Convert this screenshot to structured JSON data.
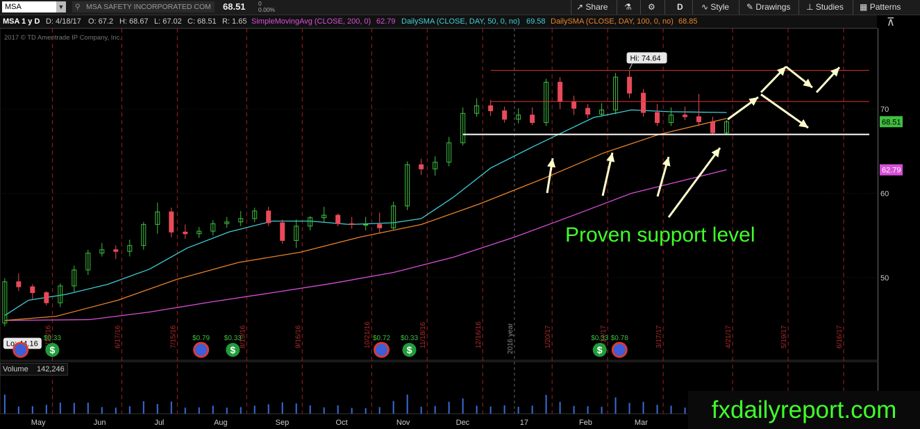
{
  "toolbar": {
    "symbol": "MSA",
    "company": "MSA SAFETY INCORPORATED COM",
    "last_price": "68.51",
    "change_top": "0",
    "change_pct": "0.00%",
    "share_label": "Share",
    "timeframe": "D",
    "style_label": "Style",
    "drawings_label": "Drawings",
    "studies_label": "Studies",
    "patterns_label": "Patterns"
  },
  "header": {
    "title": "MSA 1 y D",
    "date": "D: 4/18/17",
    "open": "O: 67.2",
    "high": "H: 68.67",
    "low": "L: 67.02",
    "close": "C: 68.51",
    "range": "R: 1.65",
    "sma200_label": "SimpleMovingAvg (CLOSE, 200, 0)",
    "sma200_value": "62.79",
    "sma50_label": "DailySMA (CLOSE, DAY, 50, 0, no)",
    "sma50_value": "69.58",
    "sma100_label": "DailySMA (CLOSE, DAY, 100, 0, no)",
    "sma100_value": "68.85"
  },
  "copyright": "2017 © TD Ameritrade IP Company, Inc.",
  "colors": {
    "sma50": "#3fd0d8",
    "sma100": "#e8832a",
    "sma200": "#d84fd8",
    "up": "#3fbf3f",
    "down": "#e84a5a",
    "annotation": "#40ff2a",
    "resistance": "#e03030",
    "support": "#ffffff"
  },
  "annotation": "Proven support level",
  "brand": "fxdailyreport.com",
  "volume": {
    "label": "Volume",
    "value": "142,246"
  },
  "chart_data": {
    "type": "candlestick",
    "title": "MSA 1 y D",
    "ylim": [
      40.5,
      79.5
    ],
    "y_ticks": [
      50,
      60,
      70
    ],
    "price_labels": {
      "last": "68.51",
      "sma200": "62.79"
    },
    "hi_label": "Hi: 74.64",
    "lo_label": "Lo: 44.16",
    "x_range": [
      "2016-04-18",
      "2017-06-30"
    ],
    "month_labels": [
      {
        "label": "May",
        "date": "2016-05-01"
      },
      {
        "label": "Jun",
        "date": "2016-06-01"
      },
      {
        "label": "Jul",
        "date": "2016-07-01"
      },
      {
        "label": "Aug",
        "date": "2016-08-01"
      },
      {
        "label": "Sep",
        "date": "2016-09-01"
      },
      {
        "label": "Oct",
        "date": "2016-10-01"
      },
      {
        "label": "Nov",
        "date": "2016-11-01"
      },
      {
        "label": "Dec",
        "date": "2016-12-01"
      },
      {
        "label": "17",
        "date": "2017-01-01"
      },
      {
        "label": "Feb",
        "date": "2017-02-01"
      },
      {
        "label": "Mar",
        "date": "2017-03-01"
      }
    ],
    "event_dates": [
      {
        "label": "5/13/16",
        "date": "2016-05-13"
      },
      {
        "label": "6/17/16",
        "date": "2016-06-17"
      },
      {
        "label": "7/15/16",
        "date": "2016-07-15"
      },
      {
        "label": "8/19/16",
        "date": "2016-08-19"
      },
      {
        "label": "9/16/16",
        "date": "2016-09-16"
      },
      {
        "label": "10/21/16",
        "date": "2016-10-21"
      },
      {
        "label": "11/18/16",
        "date": "2016-11-18"
      },
      {
        "label": "12/16/16",
        "date": "2016-12-16"
      },
      {
        "label": "1/20/17",
        "date": "2017-01-20"
      },
      {
        "label": "2/17/17",
        "date": "2017-02-17"
      },
      {
        "label": "3/17/17",
        "date": "2017-03-17"
      },
      {
        "label": "4/21/17",
        "date": "2017-04-21"
      },
      {
        "label": "5/19/17",
        "date": "2017-05-19"
      },
      {
        "label": "6/16/17",
        "date": "2017-06-16"
      }
    ],
    "year_marker": {
      "label": "2016 year",
      "date": "2017-01-01"
    },
    "events": [
      {
        "type": "earnings",
        "date": "2016-04-27"
      },
      {
        "type": "dividend",
        "label": "$0.33",
        "date": "2016-05-13"
      },
      {
        "type": "earnings",
        "label": "$0.79",
        "date": "2016-07-27"
      },
      {
        "type": "dividend",
        "label": "$0.33",
        "date": "2016-08-12"
      },
      {
        "type": "earnings",
        "label": "$0.72",
        "date": "2016-10-26"
      },
      {
        "type": "dividend",
        "label": "$0.33",
        "date": "2016-11-09"
      },
      {
        "type": "dividend",
        "label": "$0.33",
        "date": "2017-02-13"
      },
      {
        "type": "earnings",
        "label": "$0.78",
        "date": "2017-02-23"
      }
    ],
    "sma50": {
      "dates": [
        "2016-04-19",
        "2016-05-01",
        "2016-05-20",
        "2016-06-10",
        "2016-07-01",
        "2016-07-20",
        "2016-08-10",
        "2016-09-01",
        "2016-09-20",
        "2016-10-10",
        "2016-11-01",
        "2016-11-15",
        "2016-12-01",
        "2016-12-20",
        "2017-01-10",
        "2017-01-25",
        "2017-02-10",
        "2017-03-01",
        "2017-03-20",
        "2017-04-18"
      ],
      "values": [
        45.5,
        47.3,
        48.0,
        49.2,
        51.0,
        53.5,
        55.4,
        56.7,
        56.7,
        56.3,
        56.5,
        57.0,
        59.5,
        63.0,
        65.5,
        67.2,
        69.0,
        69.9,
        69.7,
        69.6
      ]
    },
    "sma100": {
      "dates": [
        "2016-04-19",
        "2016-05-15",
        "2016-06-15",
        "2016-07-15",
        "2016-08-15",
        "2016-09-15",
        "2016-10-15",
        "2016-11-15",
        "2016-12-15",
        "2017-01-15",
        "2017-02-15",
        "2017-03-15",
        "2017-04-18"
      ],
      "values": [
        44.9,
        45.4,
        47.3,
        49.8,
        51.8,
        53.0,
        54.8,
        56.3,
        58.8,
        61.7,
        64.8,
        67.0,
        68.9
      ]
    },
    "sma200": {
      "dates": [
        "2016-04-19",
        "2016-06-01",
        "2016-07-01",
        "2016-08-01",
        "2016-09-01",
        "2016-10-01",
        "2016-11-01",
        "2016-12-01",
        "2017-01-01",
        "2017-02-01",
        "2017-03-01",
        "2017-04-18"
      ],
      "values": [
        44.9,
        45.0,
        45.9,
        47.1,
        48.2,
        49.3,
        50.6,
        52.4,
        54.8,
        57.5,
        60.0,
        62.8
      ]
    },
    "candles": {
      "dates": [
        "2016-04-19",
        "2016-04-26",
        "2016-05-03",
        "2016-05-10",
        "2016-05-17",
        "2016-05-24",
        "2016-05-31",
        "2016-06-07",
        "2016-06-14",
        "2016-06-21",
        "2016-06-28",
        "2016-07-05",
        "2016-07-12",
        "2016-07-19",
        "2016-07-26",
        "2016-08-02",
        "2016-08-09",
        "2016-08-16",
        "2016-08-23",
        "2016-08-30",
        "2016-09-06",
        "2016-09-13",
        "2016-09-20",
        "2016-09-27",
        "2016-10-04",
        "2016-10-11",
        "2016-10-18",
        "2016-10-25",
        "2016-11-01",
        "2016-11-08",
        "2016-11-15",
        "2016-11-22",
        "2016-11-29",
        "2016-12-06",
        "2016-12-13",
        "2016-12-20",
        "2016-12-27",
        "2017-01-03",
        "2017-01-10",
        "2017-01-17",
        "2017-01-24",
        "2017-01-31",
        "2017-02-07",
        "2017-02-14",
        "2017-02-21",
        "2017-02-28",
        "2017-03-07",
        "2017-03-14",
        "2017-03-21",
        "2017-03-28",
        "2017-04-04",
        "2017-04-11",
        "2017-04-18"
      ],
      "open": [
        44.6,
        49.5,
        48.9,
        48.2,
        47.0,
        49.0,
        50.9,
        52.9,
        53.3,
        53.1,
        53.8,
        56.3,
        57.8,
        55.4,
        55.2,
        55.5,
        56.4,
        56.6,
        57.0,
        57.9,
        56.5,
        54.4,
        56.1,
        57.1,
        57.4,
        56.4,
        56.3,
        56.3,
        55.9,
        58.5,
        63.4,
        62.9,
        63.7,
        66.0,
        69.5,
        70.4,
        69.8,
        68.8,
        69.3,
        68.4,
        73.2,
        70.9,
        70.1,
        69.4,
        69.9,
        73.8,
        71.9,
        69.6,
        68.4,
        69.3,
        69.1,
        68.5,
        67.2
      ],
      "high": [
        49.9,
        50.5,
        49.2,
        48.4,
        49.3,
        51.4,
        53.3,
        54.1,
        53.8,
        54.5,
        56.6,
        58.9,
        58.3,
        56.3,
        56.0,
        56.8,
        57.2,
        57.9,
        58.3,
        58.4,
        56.9,
        56.9,
        57.3,
        58.4,
        57.6,
        57.2,
        57.2,
        57.7,
        59.0,
        63.8,
        64.1,
        64.4,
        66.7,
        70.2,
        71.3,
        71.1,
        70.3,
        70.1,
        70.2,
        73.6,
        73.8,
        71.6,
        70.6,
        70.7,
        74.3,
        74.6,
        72.4,
        70.6,
        70.2,
        70.3,
        71.8,
        69.1,
        68.7
      ],
      "low": [
        44.2,
        48.4,
        47.4,
        46.7,
        46.5,
        48.3,
        50.3,
        52.5,
        52.2,
        52.5,
        53.3,
        55.2,
        54.8,
        54.6,
        54.7,
        55.0,
        55.9,
        56.1,
        56.6,
        56.1,
        54.0,
        53.5,
        55.6,
        56.6,
        56.1,
        55.8,
        55.6,
        55.3,
        55.7,
        58.0,
        62.2,
        62.1,
        63.2,
        65.7,
        69.1,
        69.2,
        68.4,
        68.3,
        68.1,
        68.0,
        70.0,
        69.3,
        68.9,
        69.1,
        69.4,
        71.3,
        69.1,
        68.0,
        68.0,
        68.7,
        68.0,
        67.0,
        67.0
      ],
      "close": [
        49.5,
        48.9,
        48.2,
        47.0,
        49.0,
        50.9,
        52.9,
        53.3,
        53.1,
        53.8,
        56.3,
        57.8,
        55.4,
        55.2,
        55.5,
        56.4,
        56.6,
        57.0,
        57.9,
        56.5,
        54.4,
        56.1,
        57.1,
        57.4,
        56.4,
        56.3,
        56.3,
        55.9,
        58.5,
        63.4,
        62.9,
        63.7,
        66.0,
        69.5,
        70.4,
        69.8,
        68.8,
        69.3,
        68.4,
        73.2,
        70.9,
        70.1,
        69.4,
        69.9,
        73.8,
        71.9,
        69.6,
        68.4,
        69.3,
        69.1,
        68.5,
        67.2,
        68.5
      ]
    },
    "support_level": 67.0,
    "resistance_levels": [
      70.9,
      74.6
    ]
  }
}
